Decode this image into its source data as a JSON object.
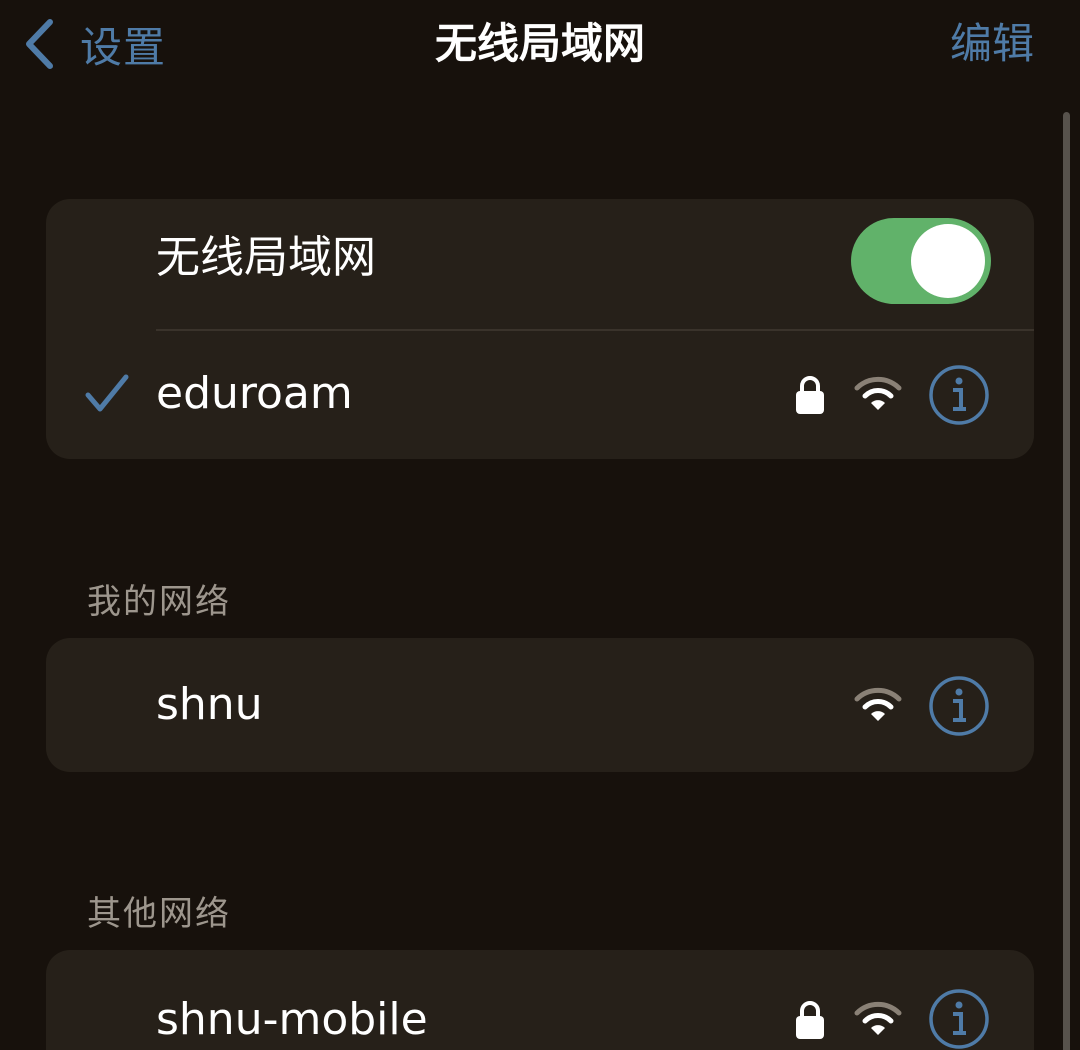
{
  "nav": {
    "back_label": "设置",
    "title": "无线局域网",
    "edit_label": "编辑"
  },
  "wifi_toggle": {
    "label": "无线局域网",
    "on": true
  },
  "connected_network": {
    "name": "eduroam",
    "connected": true,
    "secured": true,
    "icons": [
      "checkmark-icon",
      "lock-icon",
      "wifi-icon",
      "info-icon"
    ]
  },
  "my_networks": {
    "header": "我的网络",
    "items": [
      {
        "name": "shnu",
        "secured": false
      }
    ]
  },
  "other_networks": {
    "header": "其他网络",
    "items": [
      {
        "name": "shnu-mobile",
        "secured": true
      }
    ]
  },
  "colors": {
    "background": "#17110c",
    "group_background": "#262019",
    "accent_blue": "#4f7ba7",
    "toggle_green": "#61b26a",
    "section_header": "#9d968d"
  }
}
